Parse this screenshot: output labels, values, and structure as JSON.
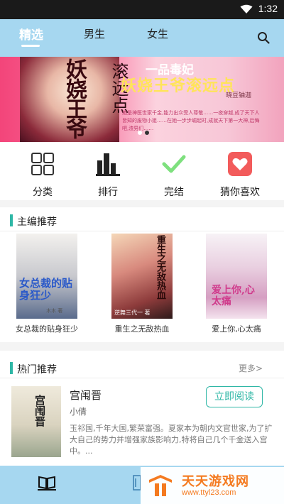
{
  "status_bar": {
    "time": "1:32",
    "wifi_icon": "wifi-icon"
  },
  "top_tabs": [
    {
      "label": "精选",
      "active": true
    },
    {
      "label": "男生",
      "active": false
    },
    {
      "label": "女生",
      "active": false
    }
  ],
  "search_icon": "search-icon",
  "banner": {
    "book_title": "妖娆王爷",
    "book_subtitle": "滚远点",
    "headline_1": "一品毒妃",
    "headline_2": "妖娆王爷滚远点",
    "author": "晓豆铀迦",
    "desc": "她是神医世家千金,能力出众受人尊敬……一夜穿越,成了天下人皆知的废物小姐……在她一步步崛起时,成就天下第一大神,后悔吧,渣男们……",
    "slide_count": 2,
    "active_slide": 2
  },
  "quick_nav": [
    {
      "label": "分类",
      "icon": "grid-icon"
    },
    {
      "label": "排行",
      "icon": "ranking-bars-icon"
    },
    {
      "label": "完结",
      "icon": "checkmark-icon"
    },
    {
      "label": "猜你喜欢",
      "icon": "heart-icon"
    }
  ],
  "editor_picks": {
    "title": "主编推荐",
    "books": [
      {
        "title": "女总裁的贴身狂少",
        "cover_text": "女总裁的贴身狂少",
        "cover_author": "木木 著"
      },
      {
        "title": "重生之无敌热血",
        "cover_text": "重生之无敌热血",
        "cover_author": "逆舞三代一 著"
      },
      {
        "title": "爱上你,心太痛",
        "cover_text": "爱上你,心太痛",
        "cover_author": ""
      }
    ]
  },
  "hot_picks": {
    "title": "热门推荐",
    "more_label": "更多>",
    "items": [
      {
        "title": "宫闱晋",
        "author": "小倩",
        "cover_text": "宫闱晋",
        "description": "玉祁国,千年大国,繁荣富强。夏家本为朝内文官世家,为了扩大自己的势力并增强家族影响力,特将自己几个千金送入宫中。...",
        "button_label": "立即阅读"
      }
    ]
  },
  "bottom_nav": [
    {
      "icon": "bookshelf-icon"
    },
    {
      "icon": "library-icon"
    }
  ],
  "watermark": {
    "name": "天天游戏网",
    "url": "www.ttyl23.com"
  },
  "colors": {
    "accent": "#2fb7a6",
    "bar": "#a6d7f0",
    "banner_pink": "#f3457a"
  }
}
